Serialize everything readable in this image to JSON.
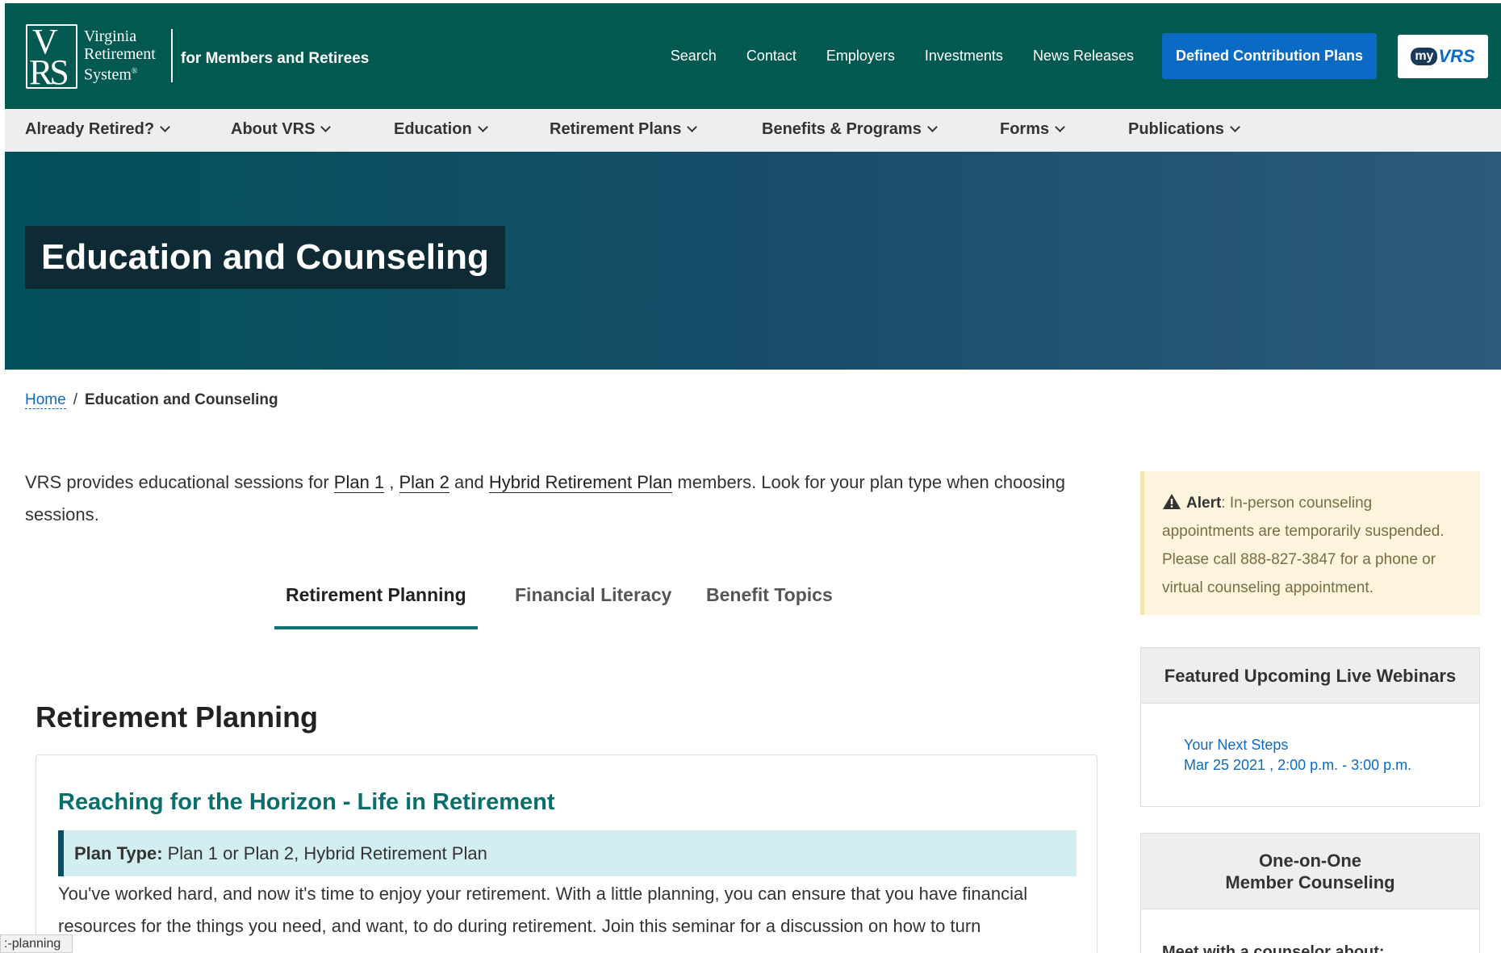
{
  "header": {
    "logo_mark_top": "V",
    "logo_mark_bottom": "RS",
    "logo_line1": "Virginia",
    "logo_line2": "Retirement",
    "logo_line3": "System",
    "logo_reg": "®",
    "tagline": "for Members and Retirees",
    "links": [
      "Search",
      "Contact",
      "Employers",
      "Investments",
      "News Releases"
    ],
    "dc_button": "Defined Contribution Plans",
    "myvrs_my": "my",
    "myvrs_vrs": "VRS"
  },
  "nav": {
    "items": [
      "Already Retired?",
      "About VRS",
      "Education",
      "Retirement Plans",
      "Benefits & Programs",
      "Forms",
      "Publications"
    ]
  },
  "hero": {
    "title": "Education and Counseling"
  },
  "breadcrumb": {
    "home": "Home",
    "separator": "/",
    "current": "Education and Counseling"
  },
  "intro": {
    "text_start": "VRS provides educational sessions for ",
    "link1": "Plan 1",
    "text_mid1": " , ",
    "link2": "Plan 2",
    "text_mid2": " and ",
    "link3": "Hybrid Retirement Plan",
    "text_end": " members. Look for your plan type when choosing sessions."
  },
  "tabs": [
    "Retirement Planning",
    "Financial Literacy",
    "Benefit Topics"
  ],
  "section": {
    "title": "Retirement Planning",
    "card_title": "Reaching for the Horizon - Life in Retirement",
    "plan_type_label": "Plan Type:",
    "plan_type_value": "Plan 1 or Plan 2, Hybrid Retirement Plan",
    "description": "You've worked hard, and now it's time to enjoy your retirement. With a little planning, you can ensure that you have financial resources for the things you need, and want, to do during retirement. Join this seminar for a discussion on how to turn"
  },
  "alert": {
    "label": "Alert",
    "text": ": In-person counseling appointments are temporarily suspended. Please call 888-827-3847 for a phone or virtual counseling appointment."
  },
  "webinars": {
    "heading": "Featured Upcoming Live Webinars",
    "item_title": "Your Next Steps",
    "item_date": "Mar 25 2021 , 2:00 p.m. - 3:00 p.m."
  },
  "counseling": {
    "heading_line1": "One-on-One",
    "heading_line2": "Member Counseling",
    "text": "Meet with a counselor about:"
  },
  "status_bar": ":-planning",
  "colors": {
    "header_bg": "#01594f",
    "accent_blue": "#0b6bc4",
    "title_teal": "#0a6e6b",
    "tab_underline": "#0e7378"
  }
}
